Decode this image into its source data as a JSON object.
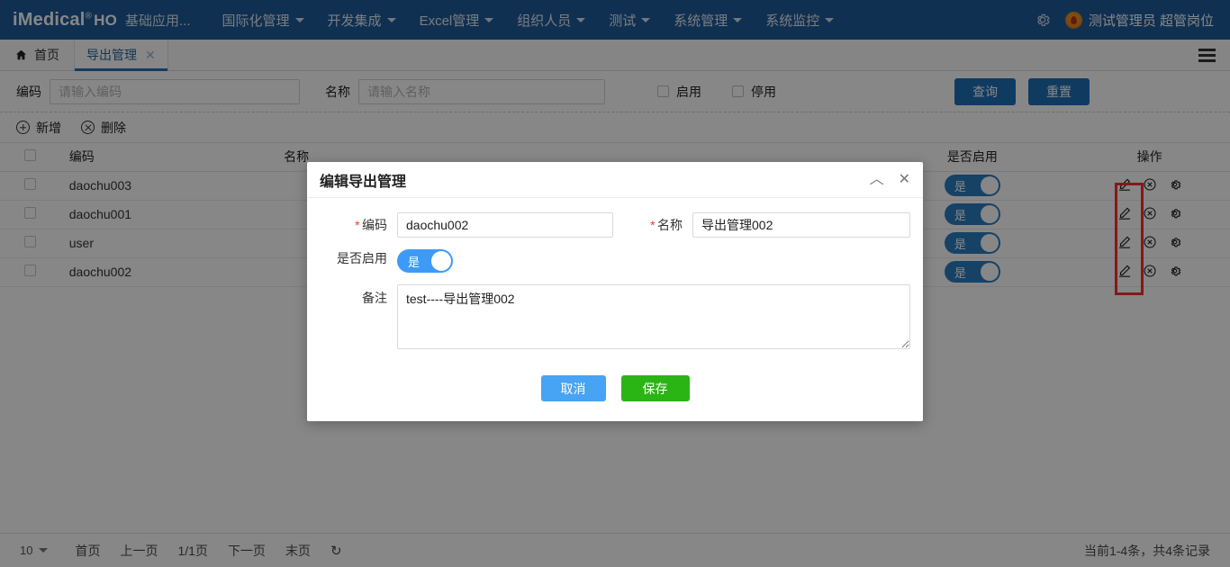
{
  "header": {
    "brand": "iMedical",
    "brand_reg": "®",
    "brand_ho": "HO",
    "brand_sub": "基础应用...",
    "nav": [
      {
        "label": "国际化管理",
        "has_caret": true
      },
      {
        "label": "开发集成",
        "has_caret": true
      },
      {
        "label": "Excel管理",
        "has_caret": true
      },
      {
        "label": "组织人员",
        "has_caret": true
      },
      {
        "label": "测试",
        "has_caret": true
      },
      {
        "label": "系统管理",
        "has_caret": true
      },
      {
        "label": "系统监控",
        "has_caret": true
      }
    ],
    "gear_icon": "gear-icon",
    "user_name": "测试管理员 超管岗位",
    "accent_color": "#1f5c99"
  },
  "tabs": {
    "home_label": "首页",
    "home_icon": "home-icon",
    "active_tab": "导出管理",
    "close_glyph": "✕",
    "menu_icon": "hamburger-icon"
  },
  "filter": {
    "code_label": "编码",
    "code_placeholder": "请输入编码",
    "code_value": "",
    "name_label": "名称",
    "name_placeholder": "请输入名称",
    "name_value": "",
    "checkbox_enabled": "启用",
    "checkbox_disabled": "停用",
    "query_button": "查询",
    "reset_button": "重置"
  },
  "toolbar": {
    "add_label": "新增",
    "delete_label": "删除"
  },
  "table": {
    "columns": [
      "",
      "编码",
      "名称",
      "是否启用",
      "操作"
    ],
    "rows": [
      {
        "code": "daochu003",
        "name": "",
        "enabled": "是"
      },
      {
        "code": "daochu001",
        "name": "",
        "enabled": "是"
      },
      {
        "code": "user",
        "name": "",
        "enabled": "是"
      },
      {
        "code": "daochu002",
        "name": "",
        "enabled": "是"
      }
    ],
    "op_icons": [
      "edit-icon",
      "delete-icon",
      "config-icon"
    ]
  },
  "annotation": {
    "color": "#ff2d2d"
  },
  "footer": {
    "page_size": "10",
    "first": "首页",
    "prev": "上一页",
    "indicator": "1/1页",
    "next": "下一页",
    "last": "末页",
    "refresh_icon": "refresh-icon",
    "total": "当前1-4条，共4条记录"
  },
  "dialog": {
    "title": "编辑导出管理",
    "collapse_glyph": "︿",
    "close_glyph": "✕",
    "code_label": "编码",
    "code_value": "daochu002",
    "name_label": "名称",
    "name_value": "导出管理002",
    "enable_label": "是否启用",
    "enable_value": "是",
    "remark_label": "备注",
    "remark_value": "test----导出管理002",
    "cancel_button": "取消",
    "save_button": "保存",
    "cancel_color": "#47a3f3",
    "save_color": "#2bb514"
  }
}
